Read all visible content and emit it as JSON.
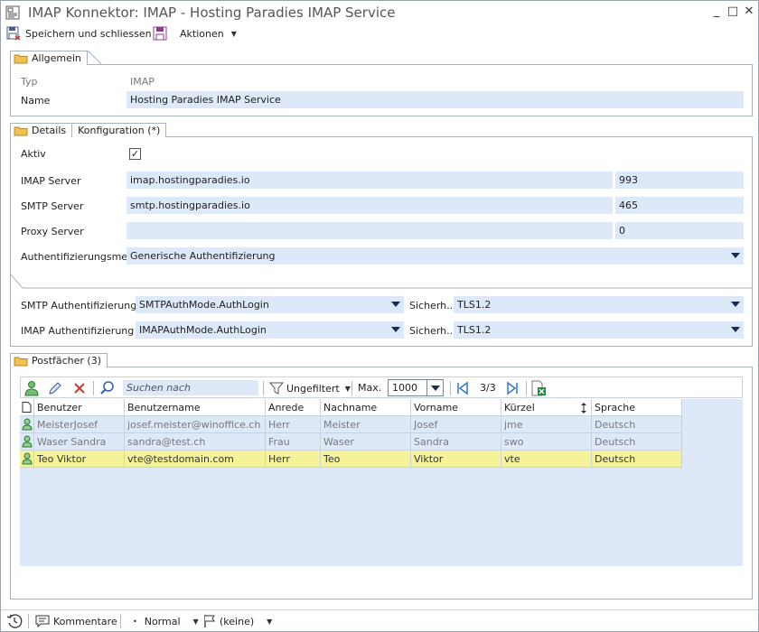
{
  "window": {
    "title": "IMAP Konnektor: IMAP - Hosting Paradies IMAP Service",
    "minimize_glyph": "_",
    "maximize_glyph": "□",
    "close_glyph": "✕"
  },
  "toolbar": {
    "save_label": "Speichern und schliessen",
    "actions_label": "Aktionen"
  },
  "general": {
    "tab_label": "Allgemein",
    "type_label": "Typ",
    "type_value": "IMAP",
    "name_label": "Name",
    "name_value": "Hosting Paradies IMAP Service"
  },
  "details": {
    "tab_details": "Details",
    "tab_config": "Konfiguration (*)",
    "active_label": "Aktiv",
    "active_checked": true,
    "check_glyph": "✓",
    "imap_server_label": "IMAP Server",
    "imap_server_value": "imap.hostingparadies.io",
    "imap_port": "993",
    "smtp_server_label": "SMTP Server",
    "smtp_server_value": "smtp.hostingparadies.io",
    "smtp_port": "465",
    "proxy_label": "Proxy Server",
    "proxy_value": "",
    "proxy_port": "0",
    "auth_method_label": "Authentifizierungsme...",
    "auth_method_value": "Generische Authentifizierung",
    "smtp_auth_label": "SMTP Authentifizierung",
    "smtp_auth_value": "SMTPAuthMode.AuthLogin",
    "smtp_security_label": "Sicherh...",
    "smtp_security_value": "TLS1.2",
    "imap_auth_label": "IMAP Authentifizierung",
    "imap_auth_value": "IMAPAuthMode.AuthLogin",
    "imap_security_label": "Sicherh...",
    "imap_security_value": "TLS1.2"
  },
  "mailboxes": {
    "tab_label": "Postfächer (3)",
    "search_placeholder": "Suchen nach",
    "filter_label": "Ungefiltert",
    "max_label": "Max.",
    "max_value": "1000",
    "page_indicator": "3/3",
    "columns": [
      "Benutzer",
      "Benutzername",
      "Anrede",
      "Nachname",
      "Vorname",
      "Kürzel",
      "Sprache"
    ],
    "rows": [
      {
        "benutzer": "MeisterJosef",
        "benutzername": "josef.meister@winoffice.ch",
        "anrede": "Herr",
        "nachname": "Meister",
        "vorname": "Josef",
        "kuerzel": "jme",
        "sprache": "Deutsch"
      },
      {
        "benutzer": "Waser Sandra",
        "benutzername": "sandra@test.ch",
        "anrede": "Frau",
        "nachname": "Waser",
        "vorname": "Sandra",
        "kuerzel": "swo",
        "sprache": "Deutsch"
      },
      {
        "benutzer": "Teo Viktor",
        "benutzername": "vte@testdomain.com",
        "anrede": "Herr",
        "nachname": "Teo",
        "vorname": "Viktor",
        "kuerzel": "vte",
        "sprache": "Deutsch"
      }
    ]
  },
  "statusbar": {
    "comments_label": "Kommentare",
    "priority_label": "Normal",
    "flag_label": "(keine)"
  },
  "colors": {
    "field_bg": "#dde8f8",
    "selected_row": "#f4f39a",
    "folder": "#f2c14e"
  }
}
